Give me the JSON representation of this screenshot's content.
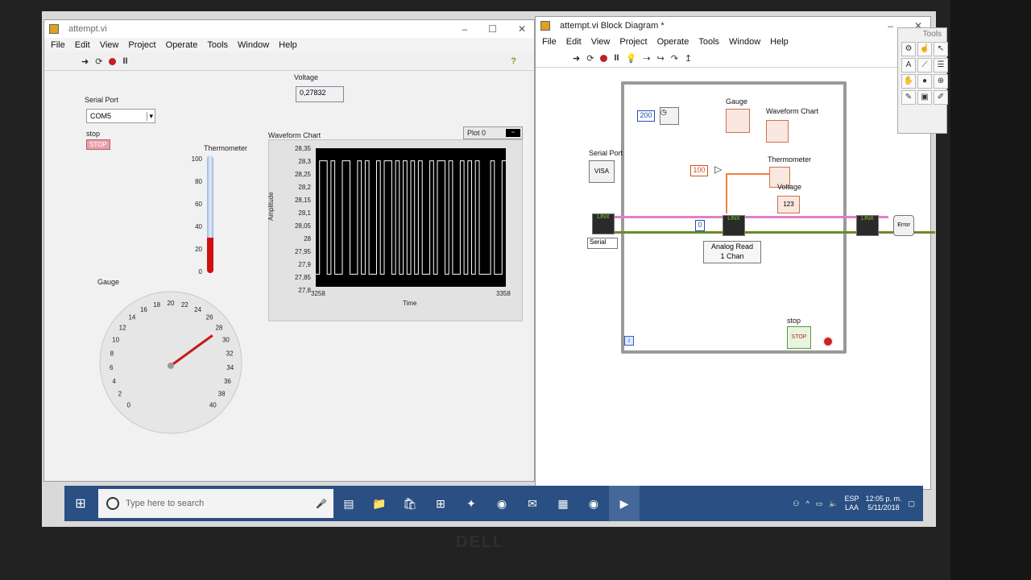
{
  "front_panel": {
    "title": "attempt.vi",
    "menu": [
      "File",
      "Edit",
      "View",
      "Project",
      "Operate",
      "Tools",
      "Window",
      "Help"
    ],
    "voltage_label": "Voltage",
    "voltage_value": "0,27832",
    "serial_port_label": "Serial Port",
    "serial_port_value": "COM5",
    "stop_label": "stop",
    "stop_button": "STOP",
    "thermometer_label": "Thermometer",
    "thermometer_ticks": [
      "100",
      "80",
      "60",
      "40",
      "20",
      "0"
    ],
    "thermometer_level": 0.3,
    "gauge_label": "Gauge",
    "gauge_ticks": [
      "0",
      "2",
      "4",
      "6",
      "8",
      "10",
      "12",
      "14",
      "16",
      "18",
      "20",
      "22",
      "24",
      "26",
      "28",
      "30",
      "32",
      "34",
      "36",
      "38",
      "40"
    ],
    "gauge_value": 28,
    "waveform_chart": {
      "label": "Waveform Chart",
      "plot_legend": "Plot 0",
      "ylabel": "Amplitude",
      "xlabel": "Time",
      "y_ticks": [
        "28,35",
        "28,3",
        "28,25",
        "28,2",
        "28,15",
        "28,1",
        "28,05",
        "28",
        "27,95",
        "27,9",
        "27,85",
        "27,8"
      ],
      "x_min": "3258",
      "x_max": "3358"
    }
  },
  "chart_data": {
    "type": "line",
    "title": "",
    "xlabel": "Time",
    "ylabel": "Amplitude",
    "xlim": [
      3258,
      3358
    ],
    "ylim": [
      27.8,
      28.35
    ],
    "series": [
      {
        "values": [
          27.85,
          28.3,
          28.3,
          27.85,
          28.3,
          27.85,
          27.85,
          28.3,
          28.3,
          27.85,
          27.85,
          28.3,
          27.85,
          28.3,
          27.85,
          27.85,
          28.3,
          27.85,
          28.3,
          28.3,
          27.85,
          28.3,
          27.85,
          28.3,
          27.85,
          28.3,
          27.85,
          28.3,
          27.85,
          27.85,
          28.3,
          27.85,
          28.3,
          28.3,
          27.85,
          28.3,
          27.85,
          27.85,
          28.3,
          27.85,
          28.3,
          27.85,
          28.3,
          27.85,
          27.85,
          27.85,
          28.3,
          27.85,
          27.85,
          28.3
        ]
      }
    ]
  },
  "block_diagram": {
    "title": "attempt.vi Block Diagram *",
    "menu": [
      "File",
      "Edit",
      "View",
      "Project",
      "Operate",
      "Tools",
      "Window",
      "Help"
    ],
    "const_200": "200",
    "const_100": "100",
    "const_0": "0",
    "gauge_label": "Gauge",
    "waveform_label": "Waveform Chart",
    "thermometer_label": "Thermometer",
    "voltage_label": "Voltage",
    "serial_port_label": "Serial Port",
    "serial_ring": "Serial",
    "analog_read_1": "Analog Read",
    "analog_read_2": "1 Chan",
    "stop_label": "stop",
    "stop_button": "STOP",
    "visa_label": "VISA",
    "linx_label": "LINX",
    "error_label": "Error"
  },
  "tools_palette": {
    "title": "Tools"
  },
  "taskbar": {
    "search_placeholder": "Type here to search",
    "lang_1": "ESP",
    "lang_2": "LAA",
    "time": "12:05 p. m.",
    "date": "5/11/2018"
  },
  "brand": "DELL"
}
